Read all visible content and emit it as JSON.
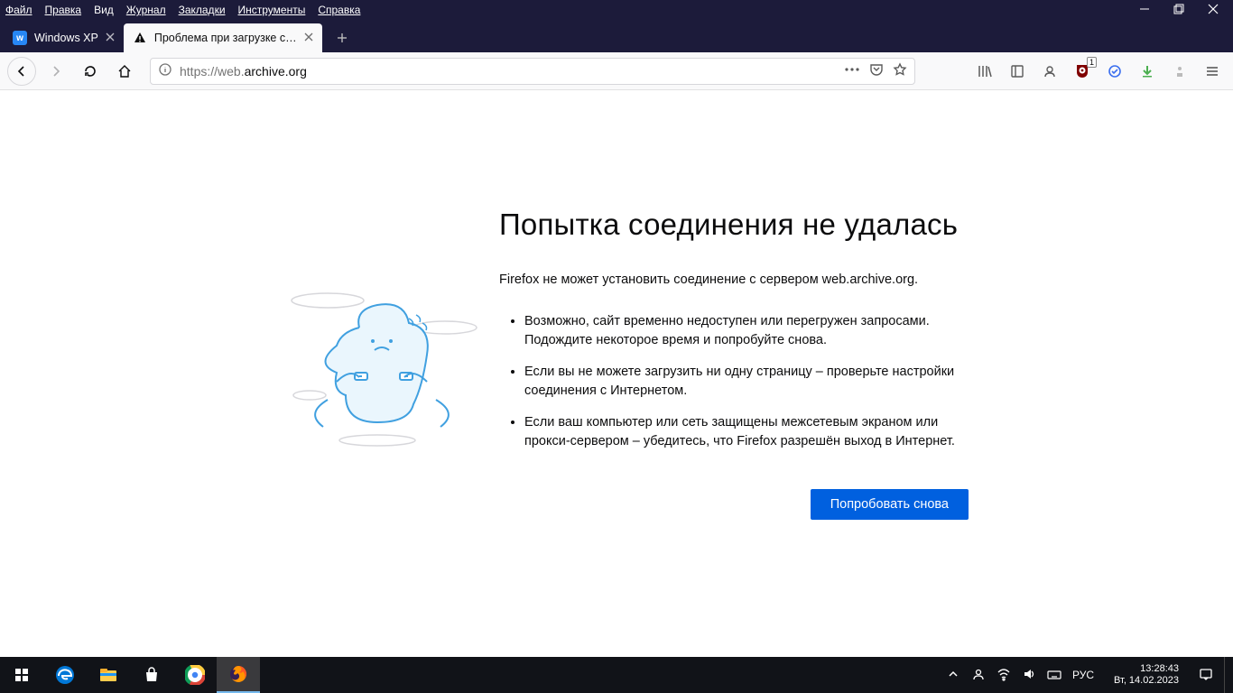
{
  "menubar": {
    "items": [
      "Файл",
      "Правка",
      "Вид",
      "Журнал",
      "Закладки",
      "Инструменты",
      "Справка"
    ]
  },
  "tabs": [
    {
      "title": "Windows XP",
      "active": false,
      "favicon": "vk"
    },
    {
      "title": "Проблема при загрузке стран",
      "active": true,
      "favicon": "warning"
    }
  ],
  "urlbar": {
    "scheme": "https://",
    "host": "web.",
    "domain": "archive.org"
  },
  "toolbar_ext": {
    "ublock_badge": "1"
  },
  "error": {
    "title": "Попытка соединения не удалась",
    "short": "Firefox не может установить соединение с сервером web.archive.org.",
    "bullets": [
      "Возможно, сайт временно недоступен или перегружен запросами. Подождите некоторое время и попробуйте снова.",
      "Если вы не можете загрузить ни одну страницу – проверьте настройки соединения с Интернетом.",
      "Если ваш компьютер или сеть защищены межсетевым экраном или прокси-сервером – убедитесь, что Firefox разрешён выход в Интернет."
    ],
    "retry_label": "Попробовать снова"
  },
  "taskbar": {
    "lang": "РУС",
    "time": "13:28:43",
    "date": "Вт, 14.02.2023"
  }
}
